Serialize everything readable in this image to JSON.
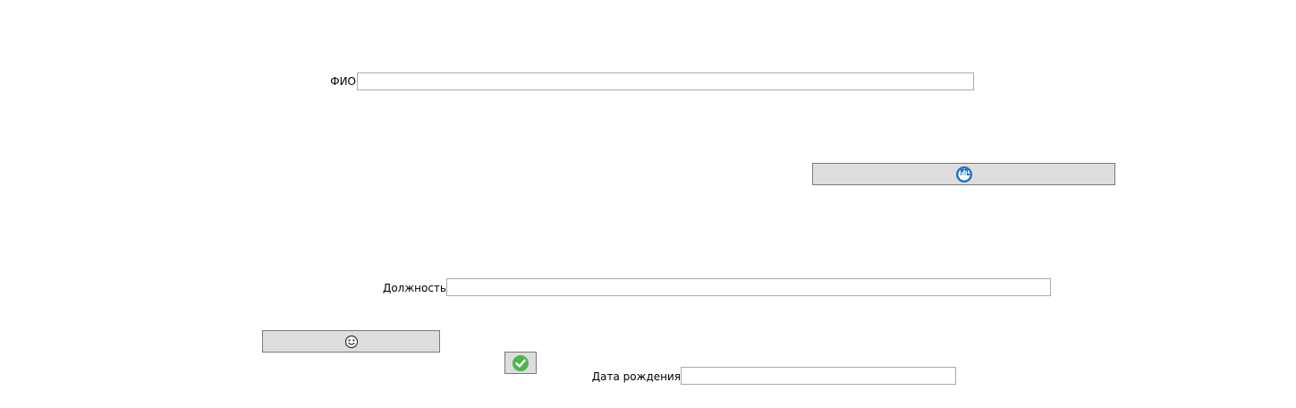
{
  "form": {
    "fio": {
      "label": "ФИО",
      "value": "",
      "placeholder": ""
    },
    "position": {
      "label": "Должность",
      "value": "",
      "placeholder": ""
    },
    "birthdate": {
      "label": "Дата рождения",
      "value": "",
      "placeholder": ""
    }
  },
  "buttons": {
    "upload": {
      "icon": "cloud-upload-icon",
      "color": "#1f73c9"
    },
    "face": {
      "icon": "smiley-face-icon"
    },
    "confirm": {
      "icon": "checkmark-icon",
      "color": "#4cb64c"
    }
  },
  "colors": {
    "button_bg": "#dddddd",
    "button_border": "#7a7a7a",
    "field_border": "#a9a9a9"
  }
}
